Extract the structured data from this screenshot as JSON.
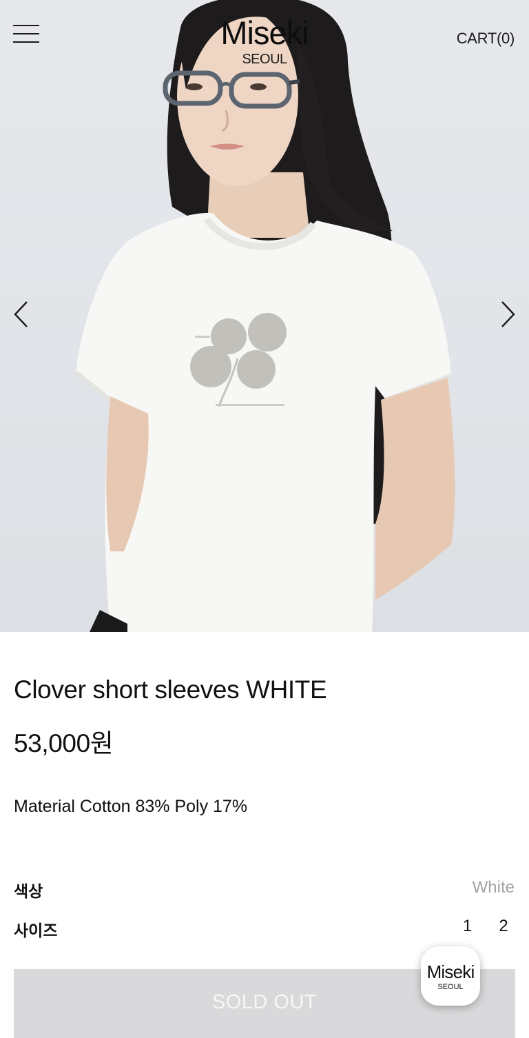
{
  "header": {
    "logo_word": "Miseki",
    "logo_sub": "SEOUL",
    "cart_label": "CART(0)"
  },
  "product": {
    "name": "Clover short sleeves WHITE",
    "price": "53,000원",
    "material": "Material Cotton 83% Poly 17%"
  },
  "options": {
    "color_label": "색상",
    "color_value": "White",
    "size_label": "사이즈",
    "sizes": [
      "1",
      "2"
    ]
  },
  "buy": {
    "soldout_label": "SOLD OUT"
  },
  "floating_badge": {
    "word": "Miseki",
    "sub": "SEOUL"
  },
  "colors": {
    "soldout_bg": "#d9d9db",
    "muted_text": "#a3a3a3",
    "hero_bg": "#e3e6ea"
  },
  "icons": {
    "menu": "hamburger-icon",
    "prev": "chevron-left-icon",
    "next": "chevron-right-icon"
  }
}
